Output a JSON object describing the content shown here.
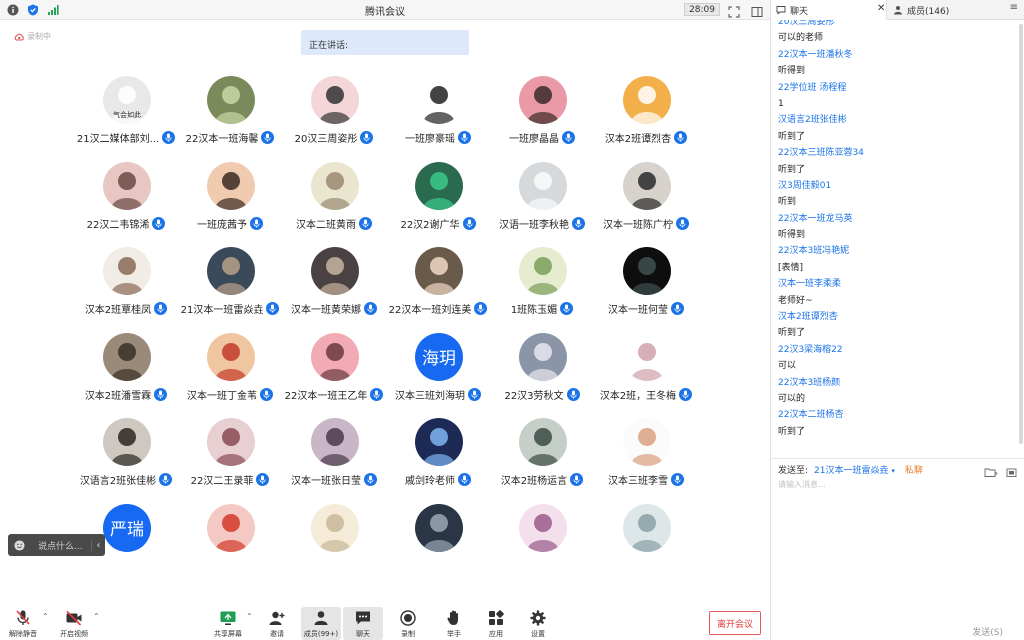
{
  "window": {
    "title": "腾讯会议",
    "timer": "28:09"
  },
  "stage": {
    "recording_label": "录制中",
    "speaking_label": "正在讲话:"
  },
  "participants": {
    "rows": [
      [
        {
          "name": "21汉二媒体部刘...",
          "avatar": "img",
          "bg": "#e8e8e8",
          "fg": "#ffffff",
          "caption": "气会如此"
        },
        {
          "name": "22汉本一班海馨",
          "avatar": "img",
          "bg": "#7a8a5a",
          "fg": "#c9d7a3"
        },
        {
          "name": "20汉三周姿彤",
          "avatar": "img",
          "bg": "#f4d5d8",
          "fg": "#333333"
        },
        {
          "name": "一班廖豪瑶",
          "avatar": "img",
          "bg": "#ffffff",
          "fg": "#222222"
        },
        {
          "name": "一班廖晶晶",
          "avatar": "img",
          "bg": "#e99aa6",
          "fg": "#3a2a2a"
        },
        {
          "name": "汉本2班谭烈杏",
          "avatar": "img",
          "bg": "#f3b04a",
          "fg": "#ffffff"
        }
      ],
      [
        {
          "name": "22汉二韦锦浠",
          "avatar": "img",
          "bg": "#e7c7c1",
          "fg": "#6b4a44"
        },
        {
          "name": "一班庞茜予",
          "avatar": "img",
          "bg": "#f1cbb0",
          "fg": "#3b2a22"
        },
        {
          "name": "汉本二班黄雨",
          "avatar": "img",
          "bg": "#e9e5cf",
          "fg": "#9a8a70"
        },
        {
          "name": "22汉2谢广华",
          "avatar": "img",
          "bg": "#2a6b4f",
          "fg": "#3ac98a"
        },
        {
          "name": "汉语一班李秋艳",
          "avatar": "img",
          "bg": "#d6d9dc",
          "fg": "#fafafa"
        },
        {
          "name": "汉本一班陈广柠",
          "avatar": "img",
          "bg": "#d8d2cc",
          "fg": "#2a2a2a"
        }
      ],
      [
        {
          "name": "汉本2班覃桂凤",
          "avatar": "img",
          "bg": "#f1ece6",
          "fg": "#8a6a55"
        },
        {
          "name": "21汉本一班雷焱垚",
          "avatar": "img",
          "bg": "#3a4a5a",
          "fg": "#b9a08a"
        },
        {
          "name": "汉本一班黄荣娜",
          "avatar": "img",
          "bg": "#4a4242",
          "fg": "#c7b3a0"
        },
        {
          "name": "22汉本一班刘连美",
          "avatar": "img",
          "bg": "#6a5a4a",
          "fg": "#f0d9c5"
        },
        {
          "name": "1班陈玉媚",
          "avatar": "img",
          "bg": "#e5ecd0",
          "fg": "#7aa05a"
        },
        {
          "name": "汉本一班何莹",
          "avatar": "img",
          "bg": "#0e0e0e",
          "fg": "#3f5050"
        }
      ],
      [
        {
          "name": "汉本2班潘雪霖",
          "avatar": "img",
          "bg": "#9a8a7a",
          "fg": "#3a3028"
        },
        {
          "name": "汉本一班丁金苇",
          "avatar": "img",
          "bg": "#f0c6a0",
          "fg": "#c23b2a"
        },
        {
          "name": "22汉本一班王乙年",
          "avatar": "img",
          "bg": "#f2aab4",
          "fg": "#6a3a40"
        },
        {
          "name": "汉本三班刘海玥",
          "avatar": "text",
          "bg": "#1669f0",
          "fg": "#ffffff",
          "label": "海玥"
        },
        {
          "name": "22汉3劳秋文",
          "avatar": "img",
          "bg": "#8a95a8",
          "fg": "#e8e8f0"
        },
        {
          "name": "汉本2班，王冬梅",
          "avatar": "img",
          "bg": "#ffffff",
          "fg": "#cfa0a8"
        }
      ],
      [
        {
          "name": "汉语言2班张佳彬",
          "avatar": "img",
          "bg": "#cfc8c0",
          "fg": "#2a2622"
        },
        {
          "name": "22汉二王录菲",
          "avatar": "img",
          "bg": "#e8cfd2",
          "fg": "#8a4a55"
        },
        {
          "name": "汉本一班张日莹",
          "avatar": "img",
          "bg": "#c9b6c6",
          "fg": "#4a3a4a"
        },
        {
          "name": "戚剑玲老师",
          "avatar": "img",
          "bg": "#1d2a55",
          "fg": "#7fb6f2"
        },
        {
          "name": "汉本2班杨运言",
          "avatar": "img",
          "bg": "#c5cfc8",
          "fg": "#3a4a44"
        },
        {
          "name": "汉本三班李雪",
          "avatar": "img",
          "bg": "#fbfbfb",
          "fg": "#d9a080"
        }
      ],
      [
        {
          "name": "",
          "avatar": "text",
          "bg": "#1669f0",
          "fg": "#ffffff",
          "label": "严瑞"
        },
        {
          "name": "",
          "avatar": "img",
          "bg": "#f4c9c4",
          "fg": "#d23a2a"
        },
        {
          "name": "",
          "avatar": "img",
          "bg": "#f4ecd8",
          "fg": "#c8b89a"
        },
        {
          "name": "",
          "avatar": "img",
          "bg": "#2a3545",
          "fg": "#9aa8b8"
        },
        {
          "name": "",
          "avatar": "img",
          "bg": "#f4e0ec",
          "fg": "#9a5a8a"
        },
        {
          "name": "",
          "avatar": "img",
          "bg": "#dde6e8",
          "fg": "#8aa0a5"
        }
      ]
    ]
  },
  "saybox": {
    "placeholder": "说点什么..."
  },
  "toolbar": {
    "mute": "解除静音",
    "video": "开启视频",
    "share": "共享屏幕",
    "invite": "邀请",
    "members": "成员(99+)",
    "chat": "聊天",
    "record": "录制",
    "raise": "举手",
    "apps": "应用",
    "settings": "设置",
    "leave": "离开会议"
  },
  "panel": {
    "chat_tab": "聊天",
    "members_tab": "成员(146)"
  },
  "chat": {
    "messages": [
      {
        "type": "sender",
        "text": "20汉三周姿彤"
      },
      {
        "type": "text",
        "text": "可以的老师"
      },
      {
        "type": "sender",
        "text": "22汉本一班潘秋冬"
      },
      {
        "type": "text",
        "text": "听得到"
      },
      {
        "type": "sender",
        "text": "22学位班 汤程程"
      },
      {
        "type": "text",
        "text": "1"
      },
      {
        "type": "sender",
        "text": "汉语言2班张佳彬"
      },
      {
        "type": "text",
        "text": "听到了"
      },
      {
        "type": "sender",
        "text": "22汉本三班陈亚蓉34"
      },
      {
        "type": "text",
        "text": "听到了"
      },
      {
        "type": "sender",
        "text": "汉3周佳毅01"
      },
      {
        "type": "text",
        "text": "听到"
      },
      {
        "type": "sender",
        "text": "22汉本一班龙马英"
      },
      {
        "type": "text",
        "text": "听得到"
      },
      {
        "type": "sender",
        "text": "22汉本3班冯艳妮"
      },
      {
        "type": "text",
        "text": "[表情]"
      },
      {
        "type": "sender",
        "text": "汉本一班李柔柔"
      },
      {
        "type": "text",
        "text": "老师好~"
      },
      {
        "type": "sender",
        "text": "汉本2班谭烈杏"
      },
      {
        "type": "text",
        "text": "听到了"
      },
      {
        "type": "sender",
        "text": "22汉3梁海榕22"
      },
      {
        "type": "text",
        "text": "可以"
      },
      {
        "type": "sender",
        "text": "22汉本3班杨颜"
      },
      {
        "type": "text",
        "text": "可以的"
      },
      {
        "type": "sender",
        "text": "22汉本二班杨杏"
      },
      {
        "type": "text",
        "text": "听到了"
      }
    ],
    "send_to_label": "发送至:",
    "send_to_target": "21汉本一班雷焱垚",
    "private_label": "私聊",
    "input_placeholder": "请输入消息...",
    "send_label": "发送(S)"
  }
}
